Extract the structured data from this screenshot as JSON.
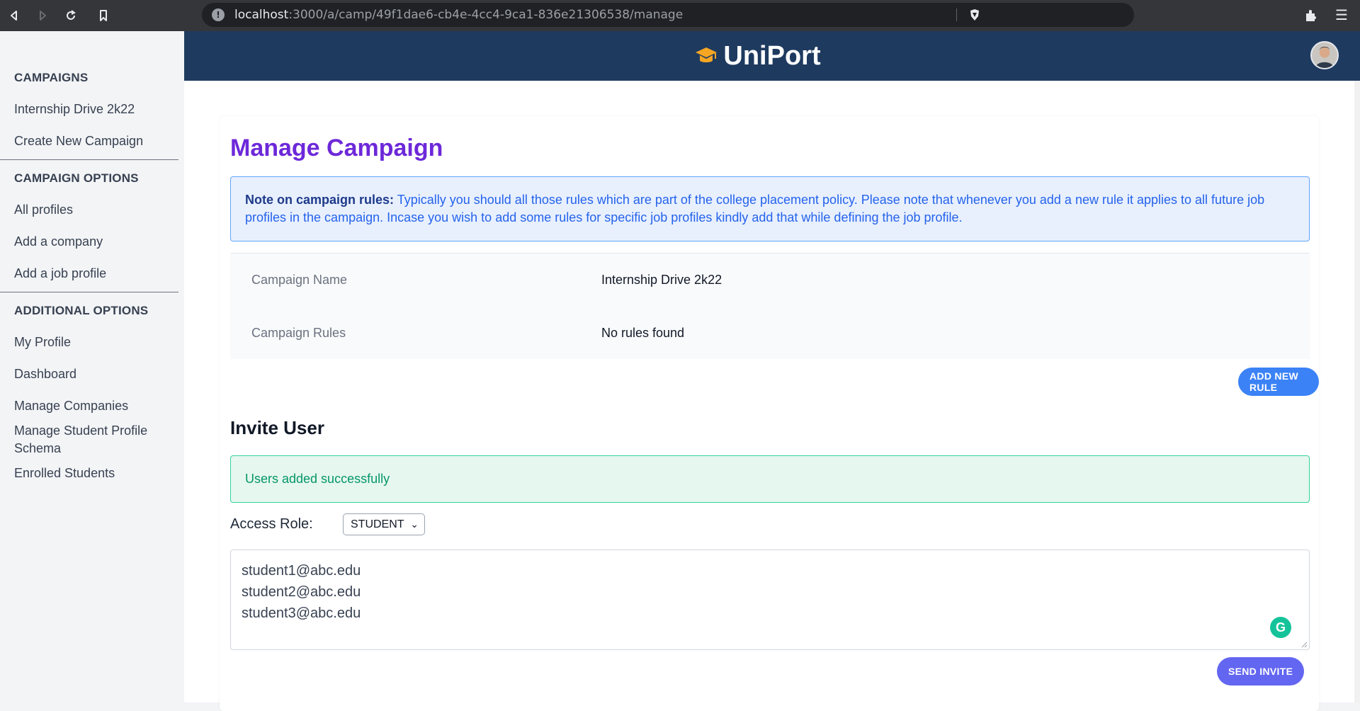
{
  "browser": {
    "url_host": "localhost",
    "url_path": ":3000/a/camp/49f1dae6-cb4e-4cc4-9ca1-836e21306538/manage"
  },
  "app": {
    "name": "UniPort",
    "brand_color": "#1e3a5f"
  },
  "sidebar": {
    "sections": [
      {
        "heading": "CAMPAIGNS",
        "items": [
          "Internship Drive 2k22",
          "Create New Campaign"
        ]
      },
      {
        "heading": "CAMPAIGN OPTIONS",
        "items": [
          "All profiles",
          "Add a company",
          "Add a job profile"
        ]
      },
      {
        "heading": "ADDITIONAL OPTIONS",
        "items": [
          "My Profile",
          "Dashboard",
          "Manage Companies",
          "Manage Student Profile Schema",
          "Enrolled Students"
        ]
      }
    ]
  },
  "main": {
    "title": "Manage Campaign",
    "note": {
      "label": "Note on campaign rules:",
      "text": " Typically you should all those rules which are part of the college placement policy. Please note that whenever you add a new rule it applies to all future job profiles in the campaign. Incase you wish to add some rules for specific job profiles kindly add that while defining the job profile."
    },
    "details": [
      {
        "label": "Campaign Name",
        "value": "Internship Drive 2k22"
      },
      {
        "label": "Campaign Rules",
        "value": "No rules found"
      }
    ],
    "add_rule_label": "ADD NEW RULE",
    "invite": {
      "title": "Invite User",
      "success_message": "Users added successfully",
      "role_label": "Access Role:",
      "role_selected": "STUDENT",
      "emails": [
        "student1@abc.edu",
        "student2@abc.edu",
        "student3@abc.edu"
      ],
      "send_label": "SEND INVITE"
    }
  },
  "colors": {
    "title": "#6d28d9",
    "primary_button": "#3b82f6",
    "invite_button": "#6366f1",
    "success": "#059669"
  }
}
